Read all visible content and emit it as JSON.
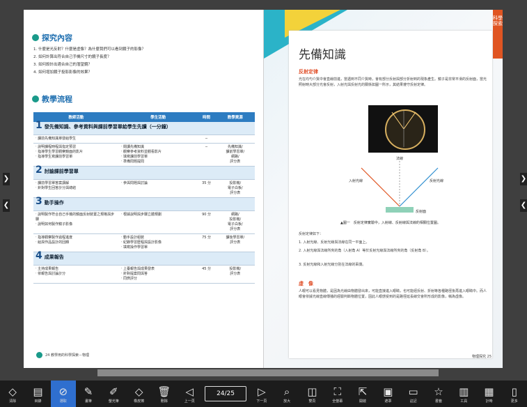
{
  "left_page": {
    "explore_title": "探究內容",
    "questions": [
      "1. 什麼是光反射？什麼是虛像？為什麼我們可以看到鏡子的影像？",
      "2. 如何計算出符合自己手機尺寸的鏡子長度？",
      "3. 如何設計出適合自己的潛望鏡？",
      "4. 如何增加鏡子投影影像的效果？"
    ],
    "flow_title": "教學流程",
    "table_headers": [
      "教師活動",
      "學生活動",
      "時間",
      "教學資源"
    ],
    "stages": [
      {
        "num": "1",
        "title": "發先備知識、參考資料與課前學習單給學生先讀（一分鐘）",
        "rows": [
          {
            "teacher": "‧ 課前先備知識單發給學生",
            "student": "",
            "time": "─",
            "res": ""
          },
          {
            "teacher": "‧ 說明課程時程與指定預習\n‧ 指導學生學習觀察鏡面的影片\n‧ 指導學生寫課前學習單",
            "student": "‧ 閱讀先備知識\n‧ 觀察參考資料並觀看影片\n‧ 填寫課前學習單\n‧ 準備問題提問",
            "time": "─",
            "res": "先備知識/\n課前學習單/\n網路/\n評分表"
          }
        ]
      },
      {
        "num": "2",
        "title": "討論課前學習單",
        "rows": [
          {
            "teacher": "‧ 課前學習單答案講解\n‧ 針對學生回答計分與總結",
            "student": "‧ 參與問題與討論",
            "time": "35 分",
            "res": "投影機/\n電子白板/\n評分表"
          }
        ]
      },
      {
        "num": "3",
        "title": "動手操作",
        "rows": [
          {
            "teacher": "‧ 說明製作符合自己手機的鏡面反射裝置之規格與步驟\n‧ 說明如何製作鏡子影像",
            "student": "‧ 根據說明與步驟立體規劃",
            "time": "90 分",
            "res": "網路/\n投影機/\n電子白板/\n評分表"
          },
          {
            "teacher": "‧ 指導觀察製作過程進度\n‧ 給與作品設計的回饋",
            "student": "‧ 動手設計組裝\n‧ 紀錄學習歷程與設計影像\n‧ 填寫操作學習單",
            "time": "75 分",
            "res": "課後學習單/\n評分表"
          }
        ]
      },
      {
        "num": "4",
        "title": "成果報告",
        "rows": [
          {
            "teacher": "‧ 主持成果報告\n‧ 依報告與討論計分",
            "student": "‧ 上臺報告與成果發表\n‧ 針對提案問與答\n‧ 同儕評分",
            "time": "45 分",
            "res": "投影機/\n評分表"
          }
        ]
      }
    ],
    "footer": "24  教學用的科學探索－物理"
  },
  "right_page": {
    "side_tab": "科學探索",
    "title": "先備知識",
    "reflection_heading": "反射定律",
    "reflection_text": "光在均勻介質中會直線前進，當遇到不同介質時，會有部分反射與部分折射到的現象產生。鏡子是非常平滑的反射面，當光照射時大部分光會反射，入射光與反射光的關係如圖一所示，其結果遵守反射定律。",
    "fig_labels": {
      "incident": "入射光線",
      "normal": "法線",
      "reflected": "反射光線",
      "surface": "反射面"
    },
    "fig_caption": "▲圖一　反射定律實驗中，入射線、反射線與法線的相關位置圖。",
    "law_intro": "反射定律如下：",
    "laws": [
      "1. 入射光線、反射光線與法線在同一平面上。",
      "2. 入射光線與法線所夾的角（入射角 A）等於反射光線與法線所夾的角（反射角 B）。",
      "3. 反射光線和入射光線分別在法線的兩側。"
    ],
    "virtual_heading": "虛　像",
    "virtual_text": "人眼可以看見物體，是因為光線由物體發出來，可能直接進入眼睛，也可能經反射、折射等各種路徑後再進入眼睛中。而人眼會依據光線直線傳播的經驗判斷物體位置，因此人眼感受到的是路徑延長線交會所形成的影像，稱為虛像。",
    "footer": "物理探究  25"
  },
  "toolbar": {
    "items": [
      {
        "icon": "◇",
        "label": "清除",
        "name": "eraser-all-icon"
      },
      {
        "icon": "▤",
        "label": "目錄",
        "name": "toc-icon"
      },
      {
        "icon": "⊘",
        "label": "選取",
        "name": "select-icon",
        "active": true
      },
      {
        "icon": "✎",
        "label": "畫筆",
        "name": "pen-icon"
      },
      {
        "icon": "✐",
        "label": "螢光筆",
        "name": "highlighter-icon"
      },
      {
        "icon": "◇",
        "label": "橡皮擦",
        "name": "eraser-icon"
      },
      {
        "icon": "🗑",
        "label": "刪除",
        "name": "trash-icon"
      },
      {
        "icon": "◁",
        "label": "上一頁",
        "name": "prev-page-icon"
      }
    ],
    "page_indicator": "24/25",
    "items_right": [
      {
        "icon": "▷",
        "label": "下一頁",
        "name": "next-page-icon"
      },
      {
        "icon": "⌕",
        "label": "放大",
        "name": "zoom-icon"
      },
      {
        "icon": "◫",
        "label": "雙頁",
        "name": "two-page-icon"
      },
      {
        "icon": "⛶",
        "label": "全螢幕",
        "name": "fullscreen-icon"
      },
      {
        "icon": "⇱",
        "label": "開啟",
        "name": "open-icon"
      },
      {
        "icon": "▣",
        "label": "遮罩",
        "name": "mask-icon"
      },
      {
        "icon": "▭",
        "label": "註記",
        "name": "note-icon"
      },
      {
        "icon": "☆",
        "label": "書籤",
        "name": "bookmark-icon"
      },
      {
        "icon": "▥",
        "label": "工具",
        "name": "tools-icon"
      },
      {
        "icon": "▦",
        "label": "計時",
        "name": "timer-icon"
      },
      {
        "icon": "▯",
        "label": "更多",
        "name": "more-icon"
      }
    ]
  },
  "nav": {
    "prev": "❮",
    "next": "❯"
  },
  "colors": {
    "accent": "#2f6fcf",
    "toolbar": "#1c1c1c",
    "heading_blue": "#1f6fb0",
    "orange": "#e05522",
    "teal": "#2bb3c8",
    "yellow": "#f3d23a"
  }
}
